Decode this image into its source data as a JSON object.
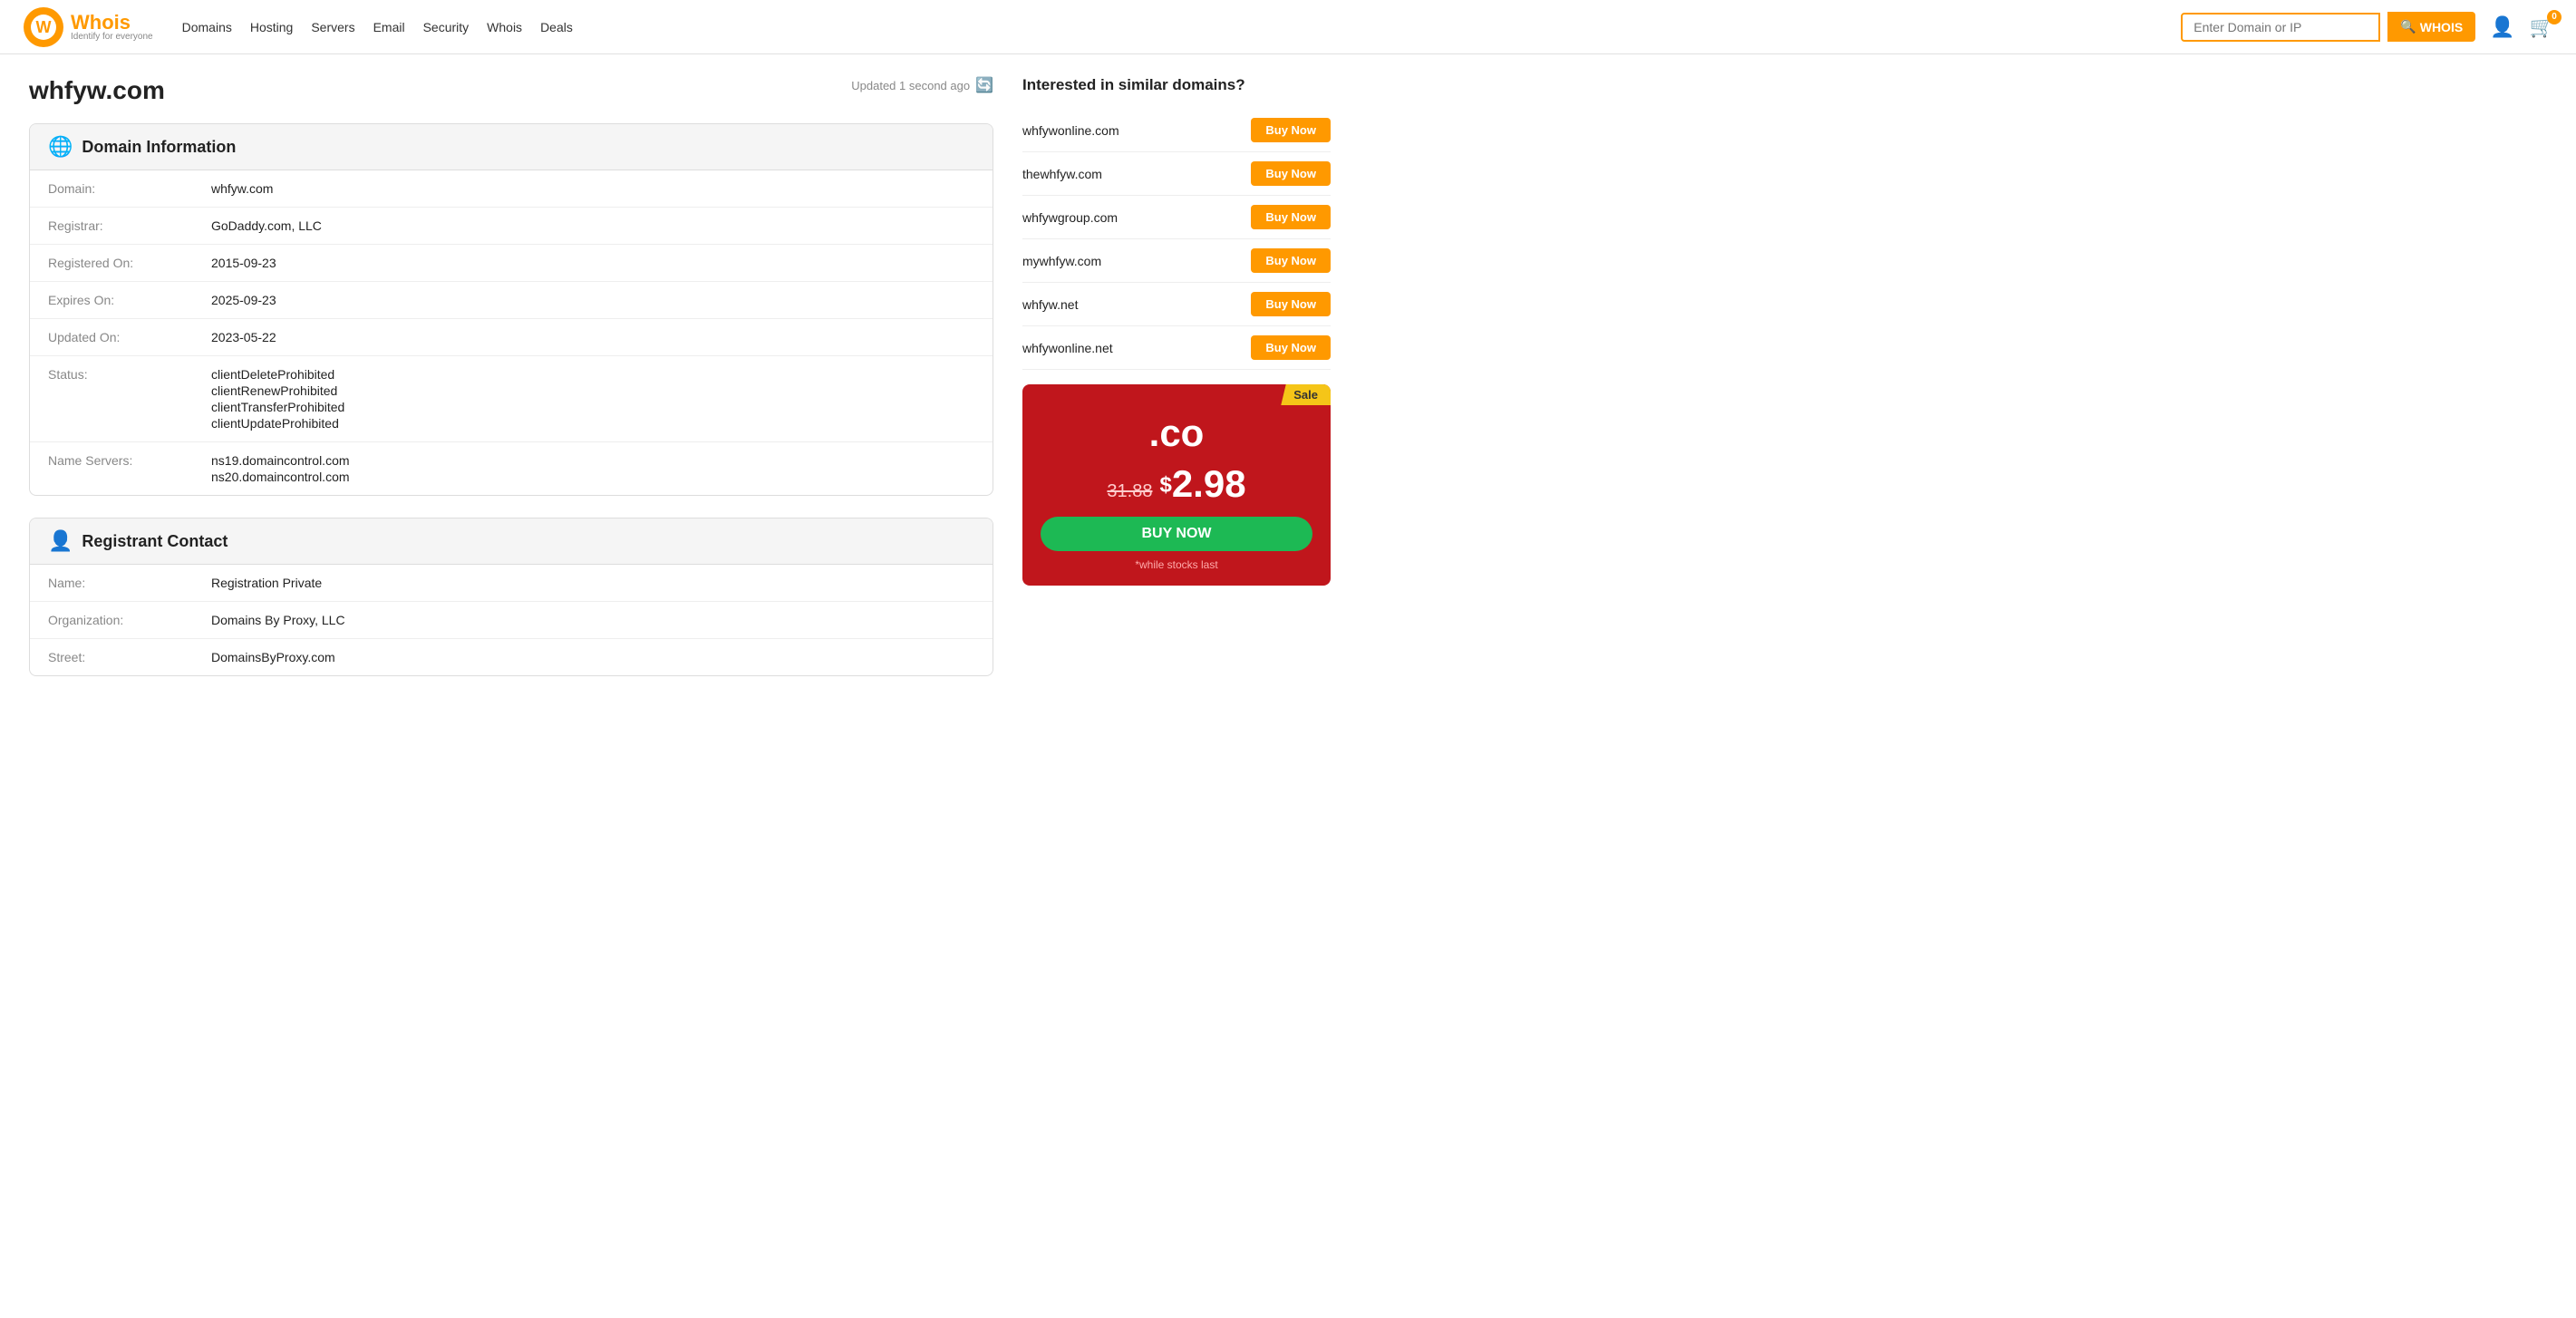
{
  "header": {
    "logo_text": "Whois",
    "logo_tagline": "Identify for everyone",
    "nav": [
      {
        "label": "Domains"
      },
      {
        "label": "Hosting"
      },
      {
        "label": "Servers"
      },
      {
        "label": "Email"
      },
      {
        "label": "Security"
      },
      {
        "label": "Whois"
      },
      {
        "label": "Deals"
      }
    ],
    "search_placeholder": "Enter Domain or IP",
    "search_btn_label": "WHOIS",
    "cart_count": "0"
  },
  "page": {
    "domain": "whfyw.com",
    "updated_text": "Updated 1 second ago"
  },
  "domain_info": {
    "section_title": "Domain Information",
    "rows": [
      {
        "label": "Domain:",
        "value": "whfyw.com"
      },
      {
        "label": "Registrar:",
        "value": "GoDaddy.com, LLC"
      },
      {
        "label": "Registered On:",
        "value": "2015-09-23"
      },
      {
        "label": "Expires On:",
        "value": "2025-09-23"
      },
      {
        "label": "Updated On:",
        "value": "2023-05-22"
      },
      {
        "label": "Status:",
        "values": [
          "clientDeleteProhibited",
          "clientRenewProhibited",
          "clientTransferProhibited",
          "clientUpdateProhibited"
        ]
      },
      {
        "label": "Name Servers:",
        "values": [
          "ns19.domaincontrol.com",
          "ns20.domaincontrol.com"
        ]
      }
    ]
  },
  "registrant": {
    "section_title": "Registrant Contact",
    "rows": [
      {
        "label": "Name:",
        "value": "Registration Private"
      },
      {
        "label": "Organization:",
        "value": "Domains By Proxy, LLC"
      },
      {
        "label": "Street:",
        "value": "DomainsByProxy.com"
      }
    ]
  },
  "sidebar": {
    "similar_title": "Interested in similar domains?",
    "domains": [
      {
        "name": "whfywonline.com",
        "btn": "Buy Now"
      },
      {
        "name": "thewhfyw.com",
        "btn": "Buy Now"
      },
      {
        "name": "whfywgroup.com",
        "btn": "Buy Now"
      },
      {
        "name": "mywhfyw.com",
        "btn": "Buy Now"
      },
      {
        "name": "whfyw.net",
        "btn": "Buy Now"
      },
      {
        "name": "whfywonline.net",
        "btn": "Buy Now"
      }
    ],
    "promo": {
      "sale_badge": "Sale",
      "tld": ".co",
      "old_price": "31.88",
      "dollar_sign": "$",
      "new_price": "2.98",
      "buy_btn": "BUY NOW",
      "disclaimer": "*while stocks last"
    }
  }
}
